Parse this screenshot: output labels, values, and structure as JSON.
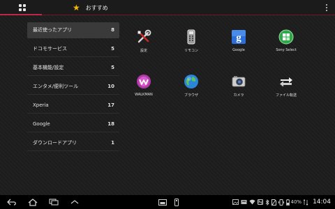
{
  "header": {
    "tab_label": "おすすめ",
    "accent_color": "#c0264a"
  },
  "categories": [
    {
      "label": "最近使ったアプリ",
      "count": "8",
      "selected": true
    },
    {
      "label": "ドコモサービス",
      "count": "5"
    },
    {
      "label": "基本機能/設定",
      "count": "5"
    },
    {
      "label": "エンタメ/便利ツール",
      "count": "10"
    },
    {
      "label": "Xperia",
      "count": "17"
    },
    {
      "label": "Google",
      "count": "18"
    },
    {
      "label": "ダウンロードアプリ",
      "count": "1"
    }
  ],
  "apps": [
    {
      "label": "設定",
      "icon": "settings-tools-icon"
    },
    {
      "label": "リモコン",
      "icon": "remote-control-icon"
    },
    {
      "label": "Google",
      "icon": "google-icon"
    },
    {
      "label": "Sony Select",
      "icon": "sony-select-icon"
    },
    {
      "label": "WALKMAN",
      "icon": "walkman-icon"
    },
    {
      "label": "ブラウザ",
      "icon": "browser-globe-icon"
    },
    {
      "label": "カメラ",
      "icon": "camera-icon"
    },
    {
      "label": "ファイル転送",
      "icon": "file-transfer-icon"
    }
  ],
  "status_bar": {
    "battery_percent": "40%",
    "clock": "14:04"
  }
}
